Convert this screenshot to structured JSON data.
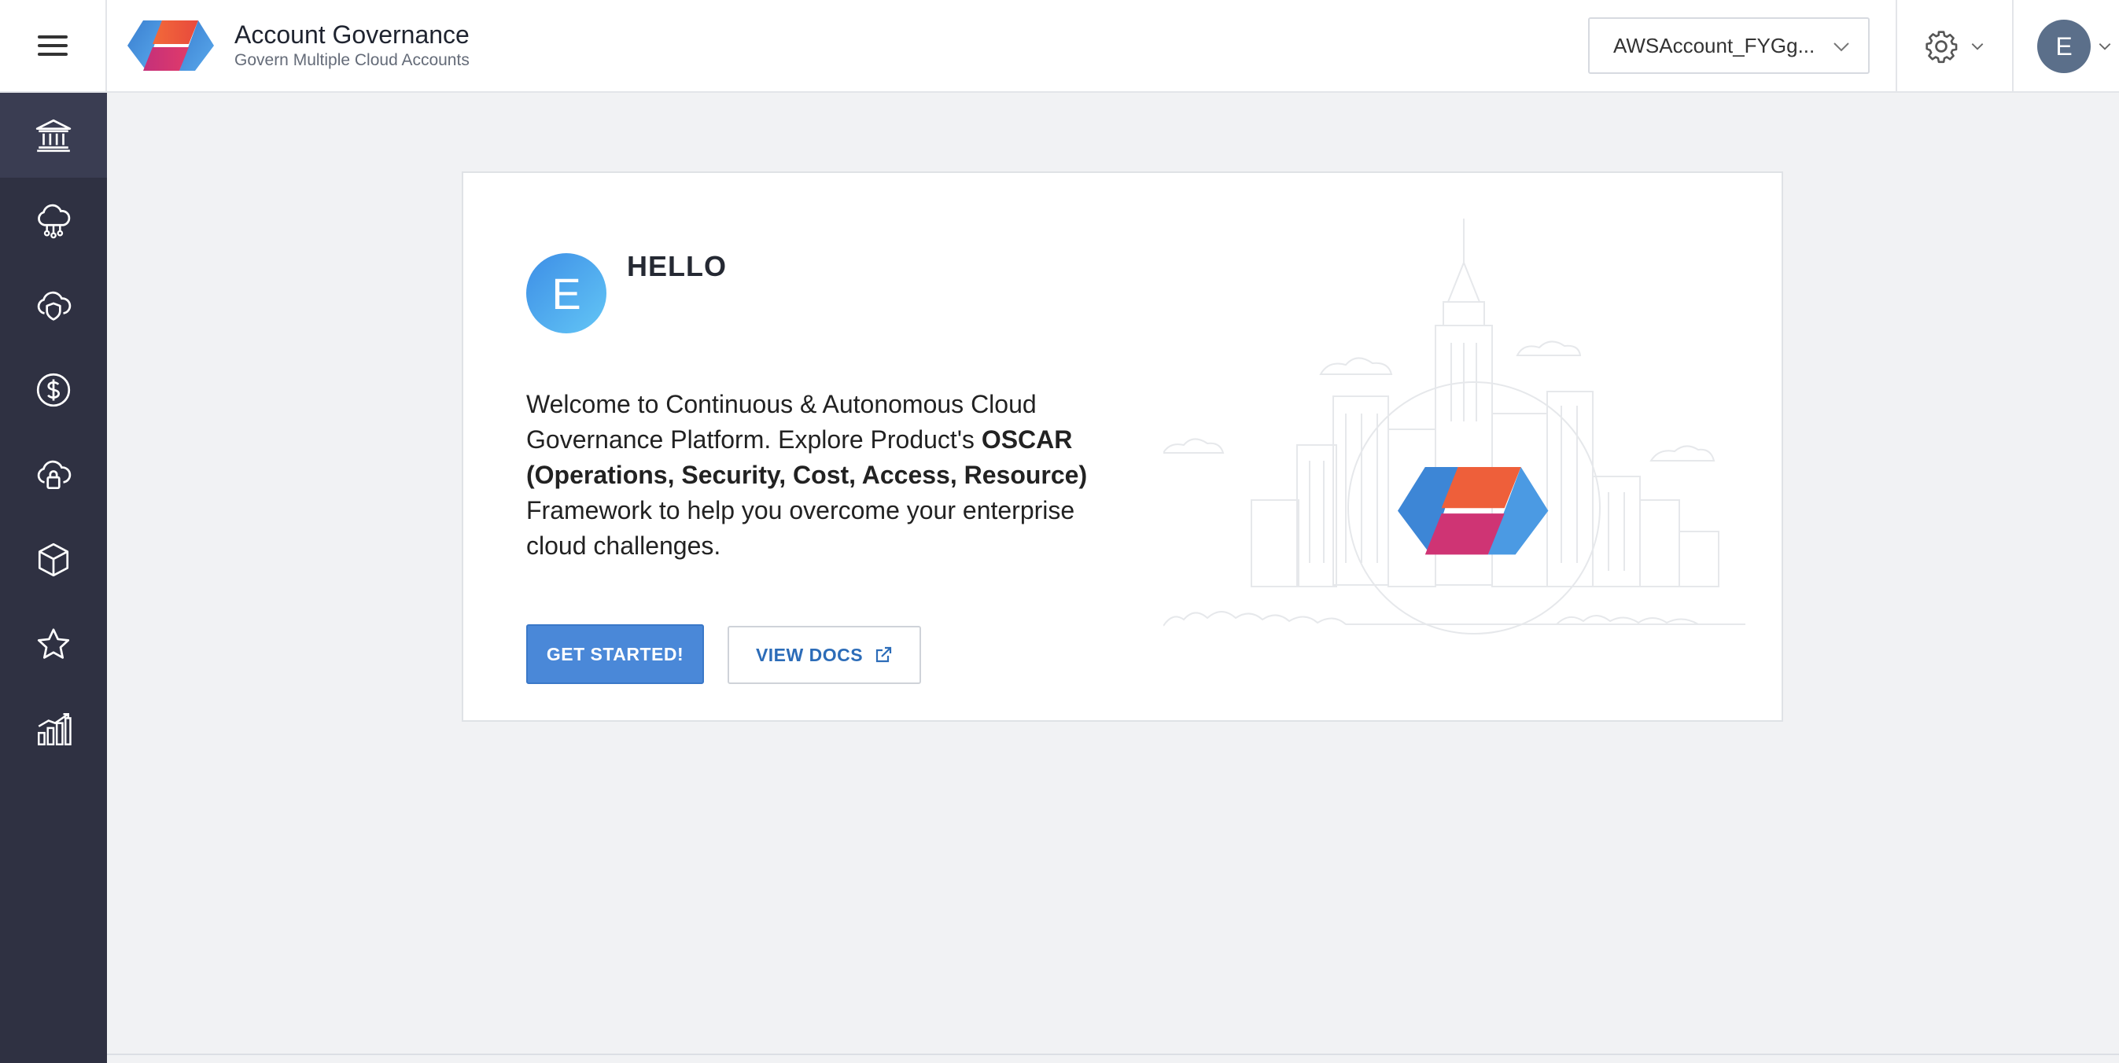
{
  "header": {
    "title": "Account Governance",
    "subtitle": "Govern Multiple Cloud Accounts",
    "account_selector": {
      "value": "AWSAccount_FYGg..."
    },
    "user_initial": "E"
  },
  "sidebar": {
    "items": [
      {
        "icon": "governance-icon",
        "active": true
      },
      {
        "icon": "cloud-network-icon",
        "active": false
      },
      {
        "icon": "cloud-shield-icon",
        "active": false
      },
      {
        "icon": "dollar-icon",
        "active": false
      },
      {
        "icon": "cloud-lock-icon",
        "active": false
      },
      {
        "icon": "cube-icon",
        "active": false
      },
      {
        "icon": "star-icon",
        "active": false
      },
      {
        "icon": "bar-chart-icon",
        "active": false
      }
    ]
  },
  "main": {
    "avatar_initial": "E",
    "greeting": "HELLO",
    "welcome_part1": "Welcome to Continuous & Autonomous Cloud Governance Platform. Explore Product's ",
    "welcome_bold": "OSCAR (Operations, Security, Cost, Access, Resource)",
    "welcome_part2": " Framework to help you overcome your enterprise cloud challenges.",
    "get_started_label": "GET STARTED!",
    "view_docs_label": "VIEW DOCS"
  },
  "colors": {
    "sidebar_bg": "#2f3142",
    "primary_button": "#4a88d8",
    "link_text": "#2c6cb8",
    "page_bg": "#f1f2f4"
  }
}
